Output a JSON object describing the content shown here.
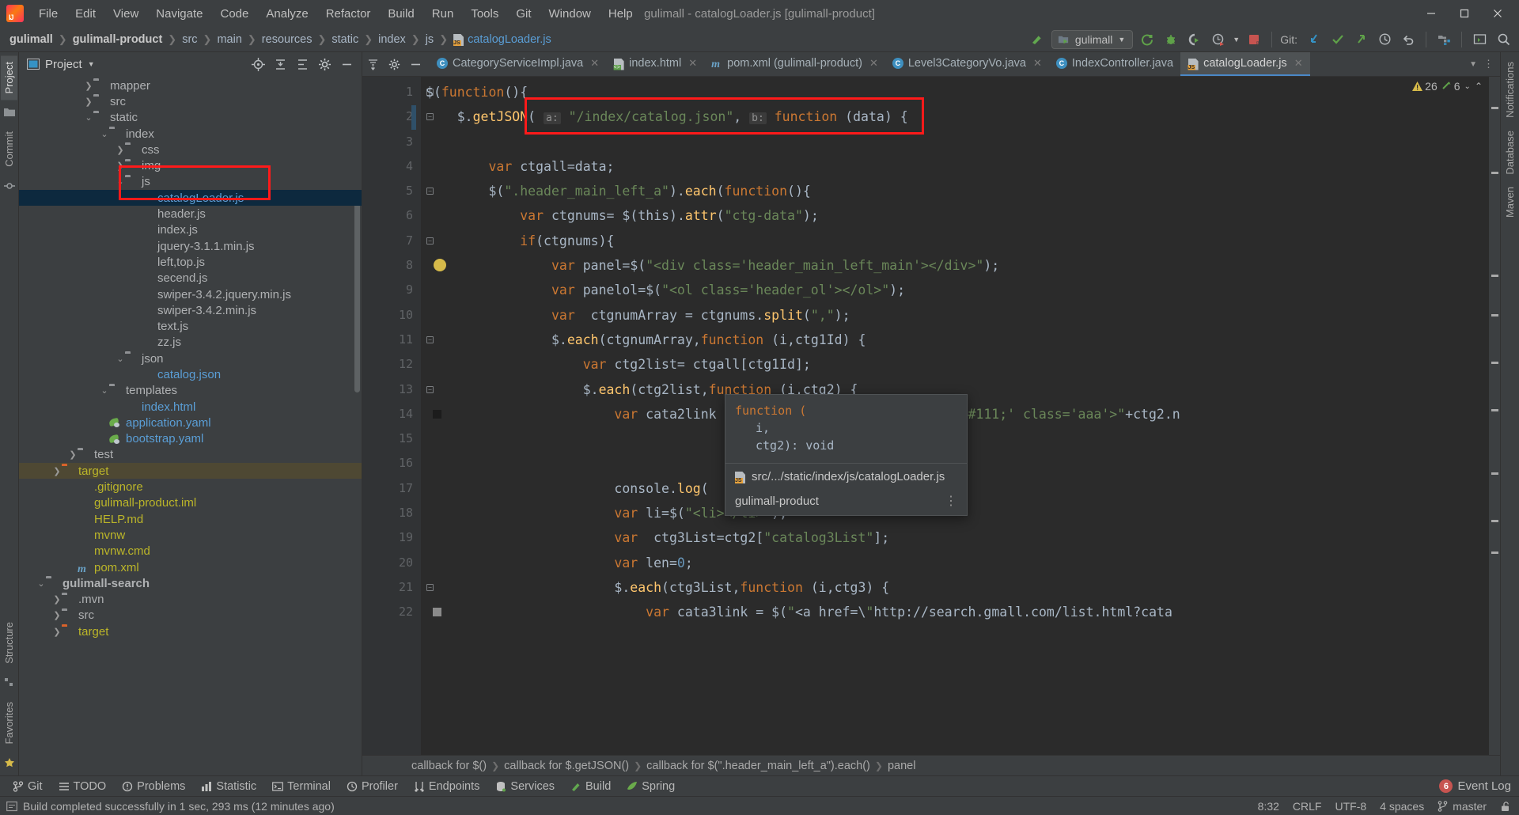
{
  "window": {
    "title": "gulimall - catalogLoader.js [gulimall-product]",
    "minimize": "—",
    "maximize": "▭",
    "close": "✕"
  },
  "menu": [
    "File",
    "Edit",
    "View",
    "Navigate",
    "Code",
    "Analyze",
    "Refactor",
    "Build",
    "Run",
    "Tools",
    "Git",
    "Window",
    "Help"
  ],
  "breadcrumb": [
    "gulimall",
    "gulimall-product",
    "src",
    "main",
    "resources",
    "static",
    "index",
    "js",
    "catalogLoader.js"
  ],
  "toolbar": {
    "run_config": "gulimall",
    "git_label": "Git:",
    "icons": [
      "build-icon",
      "run-icon",
      "debug-icon",
      "run-with-coverage-icon",
      "profiler-icon",
      "stop-icon",
      "git-update-icon",
      "git-commit-icon",
      "git-push-icon",
      "history-icon",
      "rollback-icon",
      "project-structure-icon",
      "terminal-icon",
      "search-everywhere-icon"
    ]
  },
  "project_panel": {
    "title": "Project",
    "actions": [
      "locate-icon",
      "collapse-all-icon",
      "expand-icon",
      "settings-icon",
      "hide-icon"
    ],
    "tree": [
      {
        "depth": 3,
        "arrow": "right",
        "icon": "folder",
        "label": "mapper",
        "color": "grey"
      },
      {
        "depth": 3,
        "arrow": "right",
        "icon": "folder",
        "label": "src",
        "color": "grey"
      },
      {
        "depth": 3,
        "arrow": "down",
        "icon": "folder",
        "label": "static",
        "color": "grey"
      },
      {
        "depth": 4,
        "arrow": "down",
        "icon": "folder",
        "label": "index",
        "color": "grey"
      },
      {
        "depth": 5,
        "arrow": "right",
        "icon": "folder",
        "label": "css",
        "color": "grey"
      },
      {
        "depth": 5,
        "arrow": "right",
        "icon": "folder",
        "label": "img",
        "color": "grey"
      },
      {
        "depth": 5,
        "arrow": "down",
        "icon": "folder",
        "label": "js",
        "color": "grey"
      },
      {
        "depth": 6,
        "arrow": "none",
        "icon": "js",
        "label": "catalogLoader.js",
        "color": "blue",
        "selected": true
      },
      {
        "depth": 6,
        "arrow": "none",
        "icon": "js",
        "label": "header.js",
        "color": "grey"
      },
      {
        "depth": 6,
        "arrow": "none",
        "icon": "js",
        "label": "index.js",
        "color": "grey"
      },
      {
        "depth": 6,
        "arrow": "none",
        "icon": "js-min",
        "label": "jquery-3.1.1.min.js",
        "color": "grey"
      },
      {
        "depth": 6,
        "arrow": "none",
        "icon": "js",
        "label": "left,top.js",
        "color": "grey"
      },
      {
        "depth": 6,
        "arrow": "none",
        "icon": "js",
        "label": "secend.js",
        "color": "grey"
      },
      {
        "depth": 6,
        "arrow": "none",
        "icon": "js-min",
        "label": "swiper-3.4.2.jquery.min.js",
        "color": "grey"
      },
      {
        "depth": 6,
        "arrow": "none",
        "icon": "js-min",
        "label": "swiper-3.4.2.min.js",
        "color": "grey"
      },
      {
        "depth": 6,
        "arrow": "none",
        "icon": "js",
        "label": "text.js",
        "color": "grey"
      },
      {
        "depth": 6,
        "arrow": "none",
        "icon": "js",
        "label": "zz.js",
        "color": "grey"
      },
      {
        "depth": 5,
        "arrow": "down",
        "icon": "folder",
        "label": "json",
        "color": "grey"
      },
      {
        "depth": 6,
        "arrow": "none",
        "icon": "json",
        "label": "catalog.json",
        "color": "blue"
      },
      {
        "depth": 4,
        "arrow": "down",
        "icon": "folder",
        "label": "templates",
        "color": "grey"
      },
      {
        "depth": 5,
        "arrow": "none",
        "icon": "html",
        "label": "index.html",
        "color": "blue"
      },
      {
        "depth": 4,
        "arrow": "none",
        "icon": "yaml",
        "label": "application.yaml",
        "color": "blue"
      },
      {
        "depth": 4,
        "arrow": "none",
        "icon": "yaml",
        "label": "bootstrap.yaml",
        "color": "blue"
      },
      {
        "depth": 2,
        "arrow": "right",
        "icon": "folder",
        "label": "test",
        "color": "grey"
      },
      {
        "depth": 1,
        "arrow": "right",
        "icon": "folder-orange",
        "label": "target",
        "color": "olive",
        "highlight": true
      },
      {
        "depth": 2,
        "arrow": "none",
        "icon": "gitignore",
        "label": ".gitignore",
        "color": "olive"
      },
      {
        "depth": 2,
        "arrow": "none",
        "icon": "iml",
        "label": "gulimall-product.iml",
        "color": "olive"
      },
      {
        "depth": 2,
        "arrow": "none",
        "icon": "md",
        "label": "HELP.md",
        "color": "olive"
      },
      {
        "depth": 2,
        "arrow": "none",
        "icon": "file",
        "label": "mvnw",
        "color": "olive"
      },
      {
        "depth": 2,
        "arrow": "none",
        "icon": "file",
        "label": "mvnw.cmd",
        "color": "olive"
      },
      {
        "depth": 2,
        "arrow": "none",
        "icon": "xml",
        "label": "pom.xml",
        "color": "olive"
      },
      {
        "depth": 0,
        "arrow": "down",
        "icon": "module",
        "label": "gulimall-search",
        "color": "grey",
        "bold": true
      },
      {
        "depth": 1,
        "arrow": "right",
        "icon": "folder",
        "label": ".mvn",
        "color": "grey"
      },
      {
        "depth": 1,
        "arrow": "right",
        "icon": "folder",
        "label": "src",
        "color": "grey"
      },
      {
        "depth": 1,
        "arrow": "right",
        "icon": "folder-orange",
        "label": "target",
        "color": "olive"
      }
    ]
  },
  "left_strip": {
    "tabs": [
      "Project",
      "Commit"
    ],
    "bottom_tabs": [
      "Structure",
      "Favorites"
    ]
  },
  "right_strip": {
    "tabs": [
      "Notifications",
      "Database",
      "Maven"
    ]
  },
  "editor": {
    "tabs": [
      {
        "label": "CategoryServiceImpl.java",
        "icon": "java-class-icon",
        "active": false
      },
      {
        "label": "index.html",
        "icon": "html-file-icon",
        "active": false
      },
      {
        "label": "pom.xml (gulimall-product)",
        "icon": "maven-icon",
        "active": false
      },
      {
        "label": "Level3CategoryVo.java",
        "icon": "java-class-icon",
        "active": false
      },
      {
        "label": "IndexController.java",
        "icon": "java-class-icon",
        "active": false
      },
      {
        "label": "catalogLoader.js",
        "icon": "js-file-icon",
        "active": true
      }
    ],
    "inspection": {
      "warnings": "26",
      "weak_warnings": "6"
    },
    "line_numbers": [
      "1",
      "2",
      "3",
      "4",
      "5",
      "6",
      "7",
      "8",
      "9",
      "10",
      "11",
      "12",
      "13",
      "14",
      "15",
      "16",
      "17",
      "18",
      "19",
      "20",
      "21",
      "22"
    ],
    "lines": [
      "$(function(){",
      "    $.getJSON( a: \"/index/catalog.json\", b: function (data) {",
      "",
      "        var ctgall=data;",
      "        $(\".header_main_left_a\").each(function(){",
      "            var ctgnums= $(this).attr(\"ctg-data\");",
      "            if(ctgnums){",
      "                var panel=$(\"<div class='header_main_left_main'></div>\");",
      "                var panelol=$(\"<ol class='header_ol'></ol>\");",
      "                var  ctgnumArray = ctgnums.split(\",\");",
      "                $.each(ctgnumArray,function (i,ctg1Id) {",
      "                    var ctg2list= ctgall[ctg1Id];",
      "                    $.each(ctg2list,function (i,ctg2) {",
      "                        var cata2link = $(\"<a href='#' style='color: #111;' class='aaa'>\"+ctg2.n",
      "",
      "",
      "                        console.log(",
      "                        var li=$(\"<li></li>\");",
      "                        var  ctg3List=ctg2[\"catalog3List\"];",
      "                        var len=0;",
      "                        $.each(ctg3List,function (i,ctg3) {",
      "                            var cata3link = $(\"<a href=\\\"http://search.gmall.com/list.html?cata"
    ],
    "breadcrumbs": [
      "callback for $()",
      "callback for $.getJSON()",
      "callback for $(\".header_main_left_a\").each()",
      "panel"
    ]
  },
  "popup": {
    "signature_line1": "function (",
    "signature_line2": "i,",
    "signature_line3": "ctg2): void",
    "path": "src/.../static/index/js/catalogLoader.js",
    "module": "gulimall-product",
    "menu_dots": "⋮"
  },
  "bottom_toolwindows": [
    {
      "label": "Git",
      "icon": "git-icon"
    },
    {
      "label": "TODO",
      "icon": "todo-icon"
    },
    {
      "label": "Problems",
      "icon": "problems-icon"
    },
    {
      "label": "Statistic",
      "icon": "statistic-icon"
    },
    {
      "label": "Terminal",
      "icon": "terminal-icon"
    },
    {
      "label": "Profiler",
      "icon": "profiler-icon"
    },
    {
      "label": "Endpoints",
      "icon": "endpoints-icon"
    },
    {
      "label": "Services",
      "icon": "services-icon"
    },
    {
      "label": "Build",
      "icon": "build-icon"
    },
    {
      "label": "Spring",
      "icon": "spring-icon"
    }
  ],
  "event_log": {
    "count": "6",
    "label": "Event Log"
  },
  "status_bar": {
    "message": "Build completed successfully in 1 sec, 293 ms (12 minutes ago)",
    "caret": "8:32",
    "line_separator": "CRLF",
    "encoding": "UTF-8",
    "indent": "4 spaces",
    "branch": "master",
    "lock_icon": "unlocked-icon"
  },
  "colors": {
    "accent": "#4a88c7",
    "annotation": "#ff1a1a",
    "selection": "#0d293e",
    "highlight_row": "#4e4833",
    "editor_bg": "#2b2b2b",
    "panel_bg": "#3c3f41"
  }
}
